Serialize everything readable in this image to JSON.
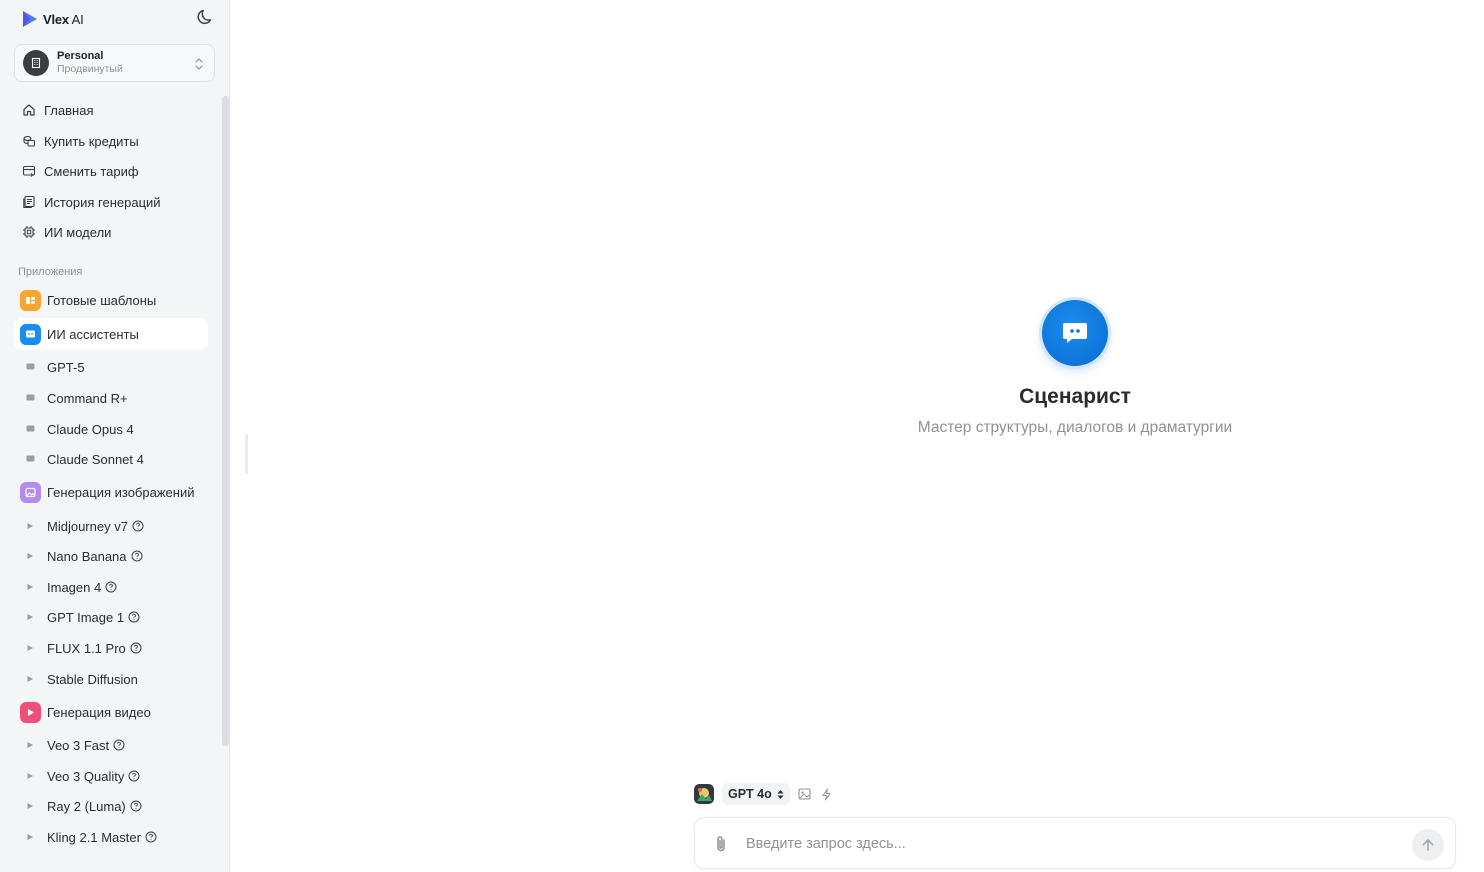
{
  "brand": {
    "name": "Vlex",
    "suffix": " AI"
  },
  "account": {
    "name": "Personal",
    "plan": "Продвинутый"
  },
  "nav": [
    {
      "label": "Главная",
      "icon": "home-icon"
    },
    {
      "label": "Купить кредиты",
      "icon": "coins-icon"
    },
    {
      "label": "Сменить тариф",
      "icon": "card-icon"
    },
    {
      "label": "История генераций",
      "icon": "history-icon"
    },
    {
      "label": "ИИ модели",
      "icon": "chip-icon"
    }
  ],
  "apps_section_label": "Приложения",
  "apps": {
    "templates": {
      "label": "Готовые шаблоны",
      "color": "#f5a530"
    },
    "assistants": {
      "label": "ИИ ассистенты",
      "color": "#1a8ef0",
      "items": [
        "GPT-5",
        "Command R+",
        "Claude Opus 4",
        "Claude Sonnet 4"
      ]
    },
    "images": {
      "label": "Генерация изображений",
      "color": "#b48cf0",
      "items": [
        "Midjourney v7",
        "Nano Banana",
        "Imagen 4",
        "GPT Image 1",
        "FLUX 1.1 Pro",
        "Stable Diffusion"
      ]
    },
    "video": {
      "label": "Генерация видео",
      "color": "#f04f7c",
      "items": [
        "Veo 3 Fast",
        "Veo 3 Quality",
        "Ray 2 (Luma)",
        "Kling 2.1 Master"
      ]
    }
  },
  "hero": {
    "title": "Сценарист",
    "subtitle": "Мастер структуры, диалогов и драматургии"
  },
  "composer": {
    "model": "GPT 4o",
    "placeholder": "Введите запрос здесь..."
  }
}
